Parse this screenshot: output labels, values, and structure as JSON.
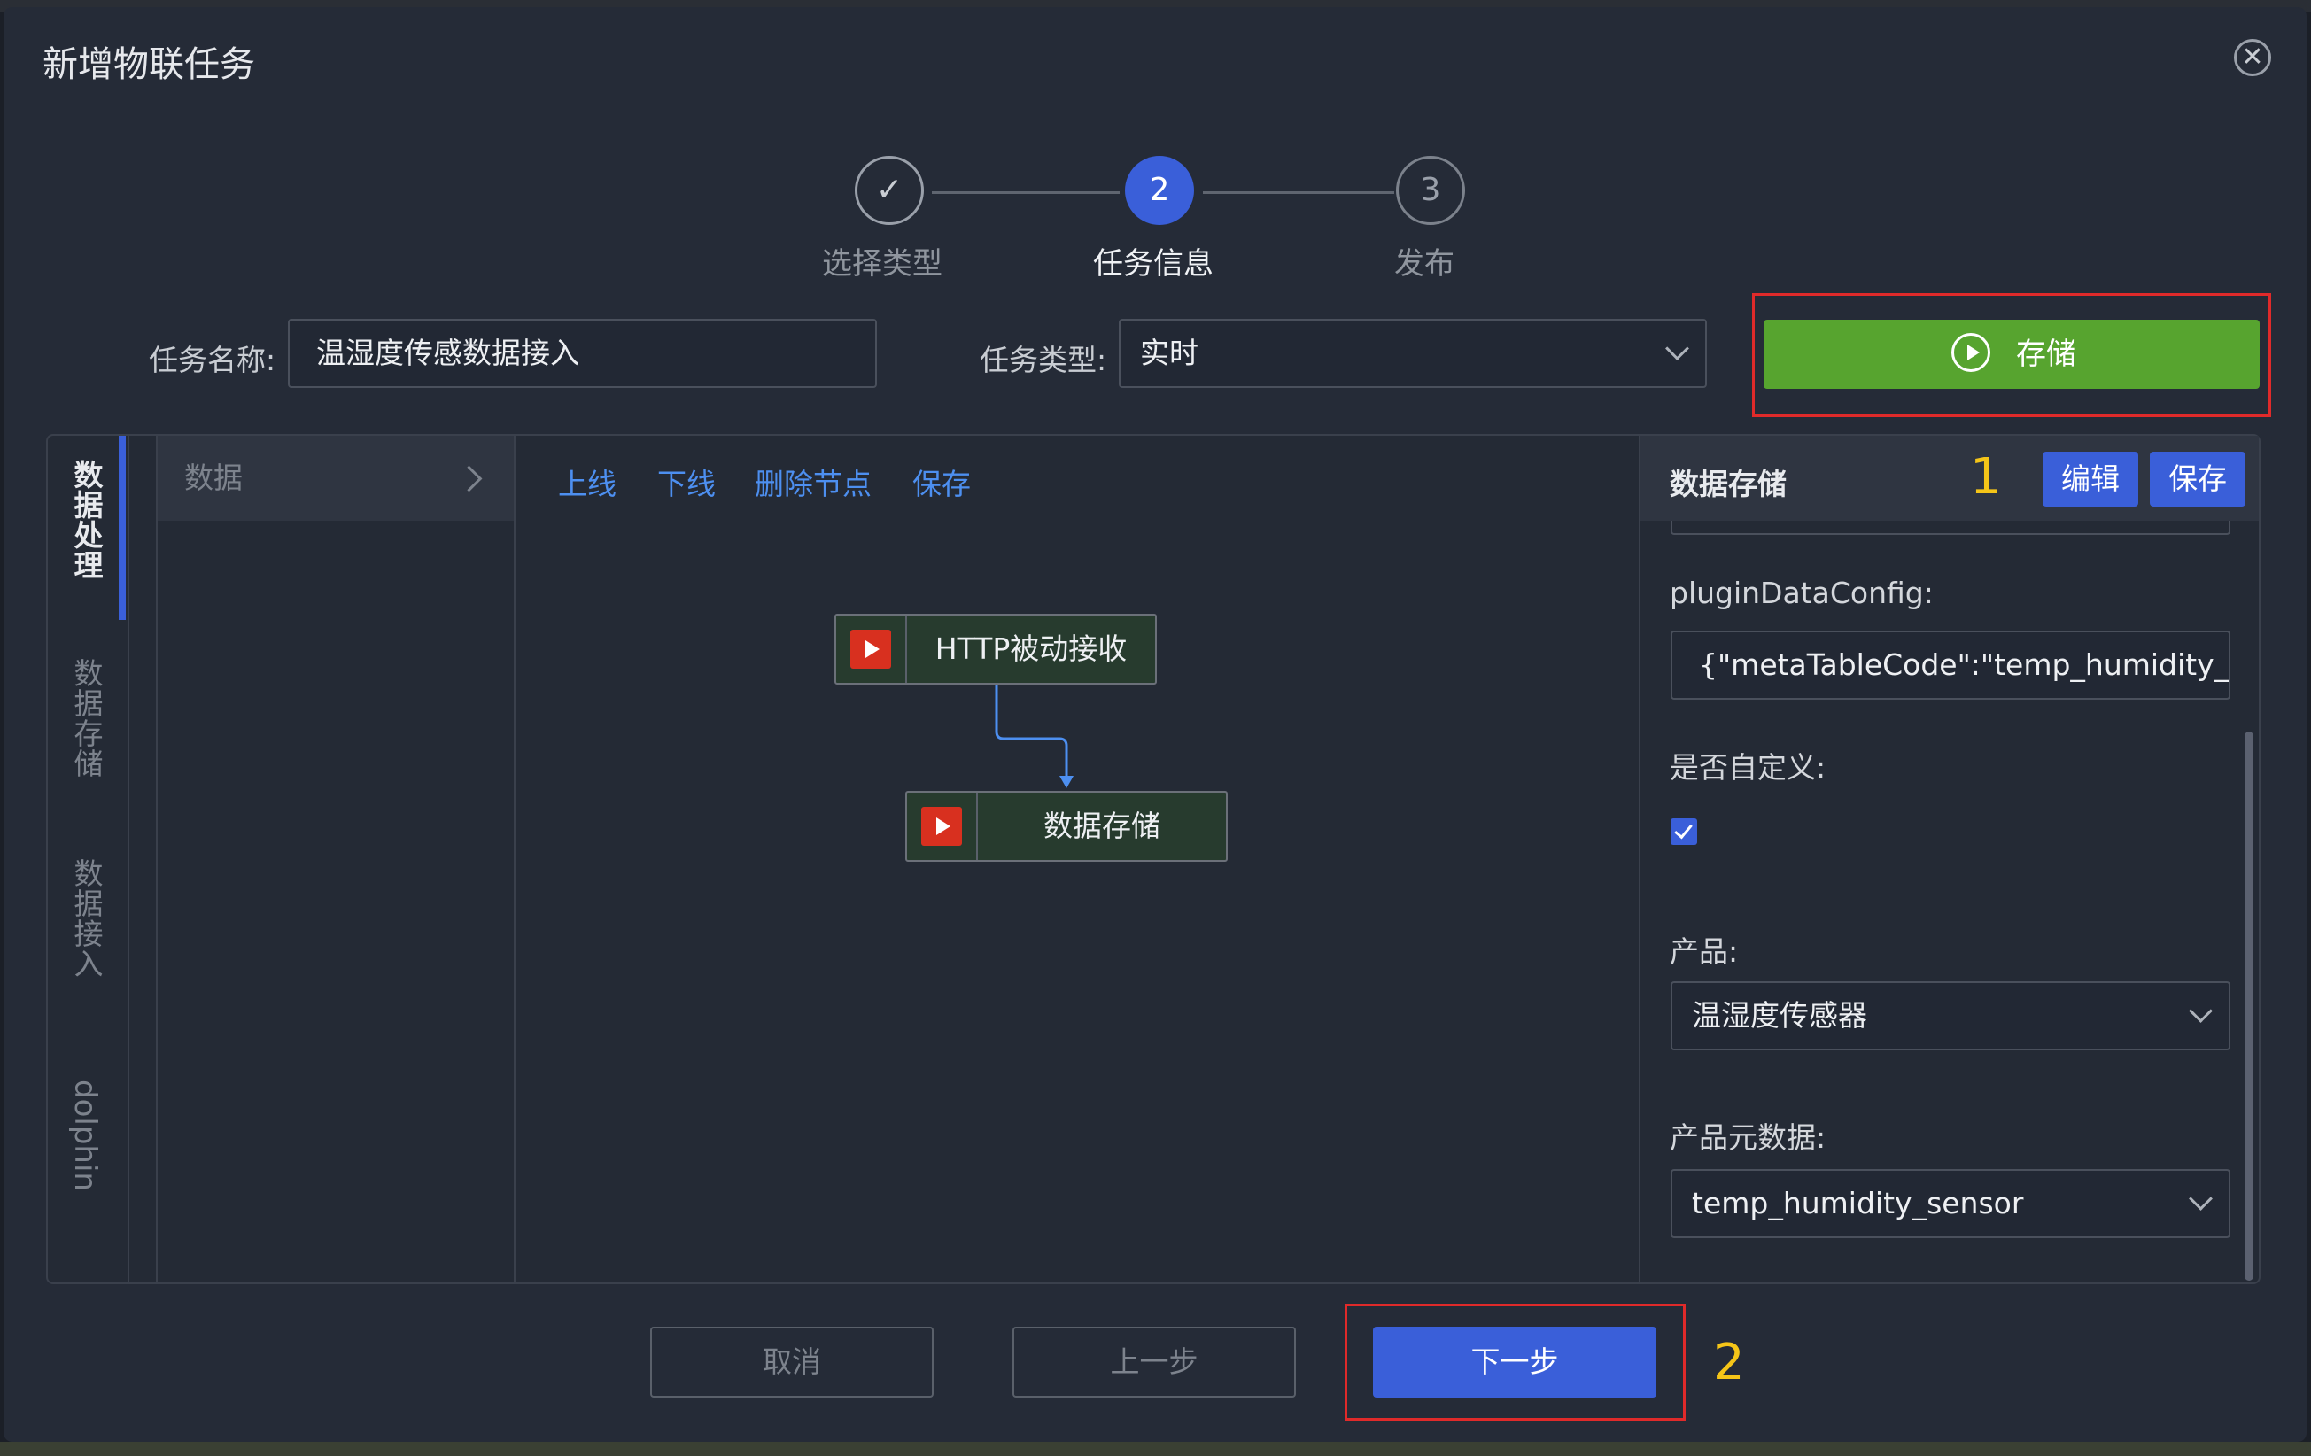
{
  "dialog": {
    "title": "新增物联任务"
  },
  "steps": [
    {
      "label": "选择类型",
      "state": "done"
    },
    {
      "label": "任务信息",
      "number": "2",
      "state": "active"
    },
    {
      "label": "发布",
      "number": "3",
      "state": "todo"
    }
  ],
  "form": {
    "task_name_label": "任务名称:",
    "task_name_value": "温湿度传感数据接入",
    "task_type_label": "任务类型:",
    "task_type_value": "实时",
    "store_button": "存储"
  },
  "vertical_tabs": [
    {
      "label": "数据处理",
      "active": true
    },
    {
      "label": "数据存储",
      "active": false
    },
    {
      "label": "数据接入",
      "active": false
    },
    {
      "label": "dolphin",
      "active": false
    }
  ],
  "tree": {
    "header": "数据"
  },
  "toolbar": {
    "online": "上线",
    "offline": "下线",
    "delete_node": "删除节点",
    "save": "保存"
  },
  "flow_nodes": [
    {
      "label": "HTTP被动接收"
    },
    {
      "label": "数据存储"
    }
  ],
  "config": {
    "title": "数据存储",
    "edit_button": "编辑",
    "save_button": "保存",
    "plugin_label": "pluginDataConfig:",
    "plugin_value": "{\"metaTableCode\":\"temp_humidity_se",
    "custom_label": "是否自定义:",
    "custom_checked": true,
    "product_label": "产品:",
    "product_value": "温湿度传感器",
    "meta_label": "产品元数据:",
    "meta_value": "temp_humidity_sensor"
  },
  "footer": {
    "cancel": "取消",
    "prev": "上一步",
    "next": "下一步"
  },
  "annotations": {
    "marker_1": "1",
    "marker_2": "2"
  },
  "colors": {
    "primary": "#3a5fd9",
    "success": "#57a42f",
    "highlight": "#e02a2a",
    "marker": "#f5c518",
    "link": "#4d8ff0"
  }
}
